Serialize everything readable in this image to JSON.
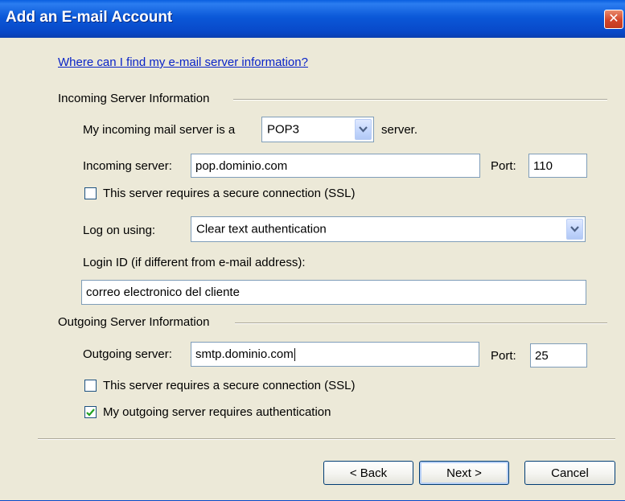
{
  "window": {
    "title": "Add an E-mail Account",
    "close_symbol": "✕"
  },
  "help_link": "Where can I find my e-mail server information?",
  "incoming": {
    "group_label": "Incoming Server Information",
    "server_type_prefix": "My incoming mail server is a",
    "server_type_value": "POP3",
    "server_type_suffix": "server.",
    "server_label": "Incoming server:",
    "server_value": "pop.dominio.com",
    "port_label": "Port:",
    "port_value": "110",
    "ssl_label": "This server requires a secure connection (SSL)",
    "ssl_checked": false,
    "logon_label": "Log on using:",
    "logon_value": "Clear text authentication",
    "login_id_label": "Login ID (if different from e-mail address):",
    "login_id_value": "correo electronico del cliente"
  },
  "outgoing": {
    "group_label": "Outgoing Server Information",
    "server_label": "Outgoing server:",
    "server_value": "smtp.dominio.com",
    "port_label": "Port:",
    "port_value": "25",
    "ssl_label": "This server requires a secure connection (SSL)",
    "ssl_checked": false,
    "auth_label": "My outgoing server requires authentication",
    "auth_checked": true
  },
  "buttons": {
    "back": "< Back",
    "next": "Next >",
    "cancel": "Cancel"
  },
  "colors": {
    "titlebar": "#0b58d8",
    "dialog_bg": "#ece9d8",
    "link": "#0a24c8",
    "close": "#d2452a"
  }
}
